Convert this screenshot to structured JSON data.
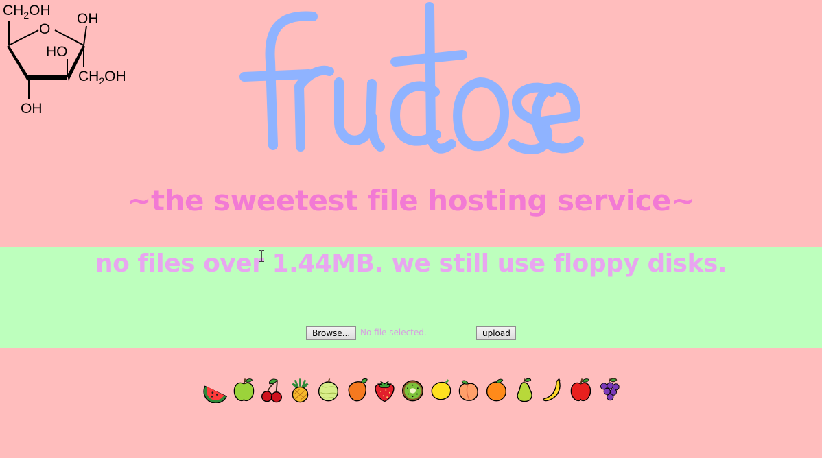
{
  "molecule": {
    "ch2oh_top_left": "CH",
    "ch2oh_top_left_sub": "2",
    "ch2oh_top_left_tail": "OH",
    "ring_oxygen": "O",
    "oh_top_right": "OH",
    "ho_inner": "HO",
    "ch2oh_right": "CH",
    "ch2oh_right_sub": "2",
    "ch2oh_right_tail": "OH",
    "oh_bottom": "OH"
  },
  "logo": {
    "text": "fructose"
  },
  "tagline": "~the sweetest file hosting service~",
  "upload": {
    "notice": "no files over 1.44MB. we still use floppy disks.",
    "browse_label": "Browse...",
    "file_status": "No file selected.",
    "upload_label": "upload"
  },
  "fruit_icons": [
    "watermelon-icon",
    "green-apple-icon",
    "cherries-icon",
    "pineapple-icon",
    "melon-icon",
    "tangerine-icon",
    "strawberry-icon",
    "kiwi-icon",
    "lemon-icon",
    "peach-icon",
    "orange-icon",
    "pear-icon",
    "banana-icon",
    "red-apple-icon",
    "grapes-icon"
  ],
  "colors": {
    "background": "#ffbdbd",
    "upload_band": "#bdffbd",
    "logo": "#8fb3ff",
    "tagline": "#f27ad4",
    "notice": "#e8a5f0"
  }
}
